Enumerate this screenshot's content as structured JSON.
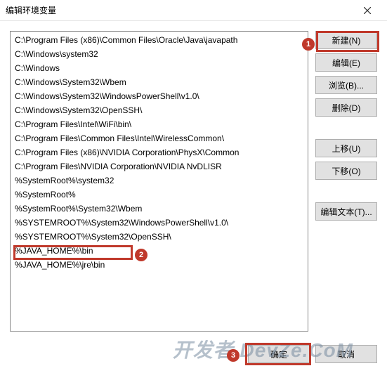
{
  "title": "编辑环境变量",
  "list": [
    "C:\\Program Files (x86)\\Common Files\\Oracle\\Java\\javapath",
    "C:\\Windows\\system32",
    "C:\\Windows",
    "C:\\Windows\\System32\\Wbem",
    "C:\\Windows\\System32\\WindowsPowerShell\\v1.0\\",
    "C:\\Windows\\System32\\OpenSSH\\",
    "C:\\Program Files\\Intel\\WiFi\\bin\\",
    "C:\\Program Files\\Common Files\\Intel\\WirelessCommon\\",
    "C:\\Program Files (x86)\\NVIDIA Corporation\\PhysX\\Common",
    "C:\\Program Files\\NVIDIA Corporation\\NVIDIA NvDLISR",
    "%SystemRoot%\\system32",
    "%SystemRoot%",
    "%SystemRoot%\\System32\\Wbem",
    "%SYSTEMROOT%\\System32\\WindowsPowerShell\\v1.0\\",
    "%SYSTEMROOT%\\System32\\OpenSSH\\",
    "%JAVA_HOME%\\bin",
    "%JAVA_HOME%\\jre\\bin"
  ],
  "buttons": {
    "new": "新建(N)",
    "edit": "编辑(E)",
    "browse": "浏览(B)...",
    "delete": "删除(D)",
    "moveup": "上移(U)",
    "movedown": "下移(O)",
    "edittext": "编辑文本(T)...",
    "ok": "确定",
    "cancel": "取消"
  },
  "callouts": {
    "c1": "1",
    "c2": "2",
    "c3": "3"
  },
  "watermark": "开发者 DevZe.CoM"
}
